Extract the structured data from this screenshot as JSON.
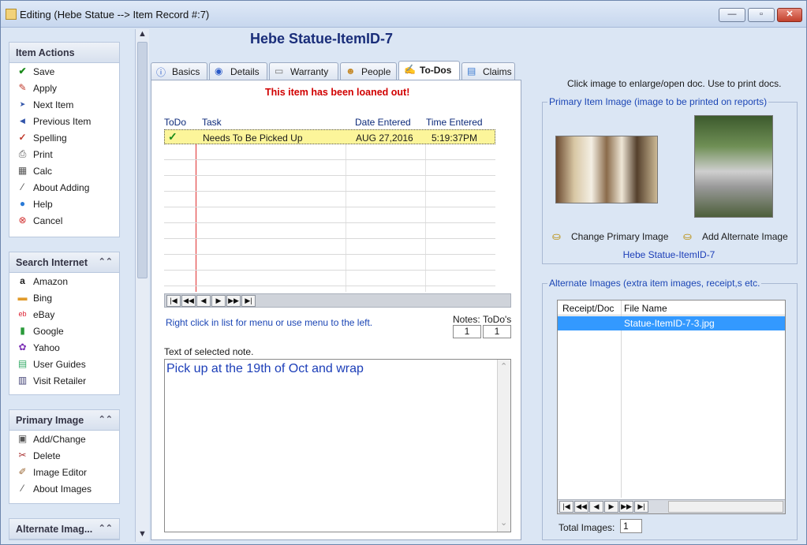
{
  "window": {
    "title": "Editing  (Hebe Statue --> Item Record #:7)",
    "btn_min": "—",
    "btn_max": "▫",
    "btn_close": "✕"
  },
  "sidebar": {
    "item_actions": {
      "title": "Item Actions",
      "items": [
        "Save",
        "Apply",
        "Next Item",
        "Previous Item",
        "Spelling",
        "Print",
        "Calc",
        "About Adding",
        "Help",
        "Cancel"
      ]
    },
    "search_internet": {
      "title": "Search Internet",
      "items": [
        "Amazon",
        "Bing",
        "eBay",
        "Google",
        "Yahoo",
        "User Guides",
        "Visit Retailer"
      ]
    },
    "primary_image": {
      "title": "Primary Image",
      "items": [
        "Add/Change",
        "Delete",
        "Image Editor",
        "About Images"
      ]
    },
    "alternate_images": {
      "title": "Alternate Imag..."
    },
    "chevron": "⌃⌃"
  },
  "center": {
    "title": "Hebe Statue-ItemID-7",
    "tabs": [
      "Basics",
      "Details",
      "Warranty",
      "People",
      "To-Dos",
      "Claims"
    ],
    "active_tab": "To-Dos",
    "loaned_msg": "This item has been loaned out!",
    "columns": [
      "ToDo",
      "Task",
      "Date Entered",
      "Time Entered"
    ],
    "rows": [
      {
        "done": "✓",
        "task": "Needs To Be Picked Up",
        "date": "AUG 27,2016",
        "time": "5:19:37PM"
      }
    ],
    "nav": [
      "|◀",
      "◀◀",
      "◀",
      "▶",
      "▶▶",
      "▶|"
    ],
    "hint": "Right click in list for menu or use menu to the left.",
    "notes_label": "Notes:",
    "todos_label": "ToDo's",
    "notes_count": "1",
    "todos_count": "1",
    "note_label": "Text of selected note.",
    "note_text": "Pick up at the 19th of Oct and wrap"
  },
  "right": {
    "click_hint": "Click image to enlarge/open doc. Use to print docs.",
    "primary_legend": "Primary Item Image (image to be printed on reports)",
    "change_primary": "Change Primary Image",
    "add_alternate": "Add Alternate Image",
    "image_name": "Hebe Statue-ItemID-7",
    "alt_legend": "Alternate Images (extra item images, receipt,s etc.",
    "alt_columns": [
      "Receipt/Doc",
      "File Name"
    ],
    "alt_rows": [
      {
        "receipt": "",
        "file": "Statue-ItemID-7-3.jpg"
      }
    ],
    "total_label": "Total Images:",
    "total_value": "1"
  }
}
